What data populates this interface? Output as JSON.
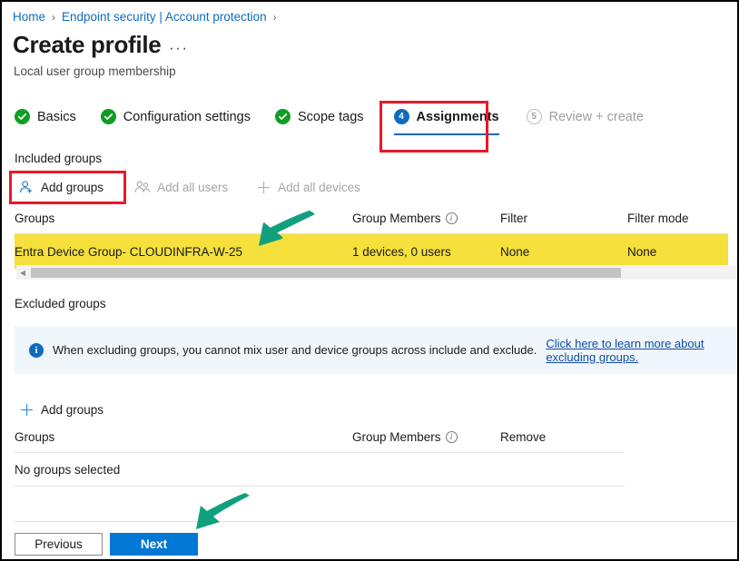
{
  "breadcrumb": {
    "items": [
      {
        "label": "Home",
        "separator": "›"
      },
      {
        "label": "Endpoint security | Account protection",
        "separator": "›"
      }
    ]
  },
  "header": {
    "title": "Create profile",
    "ellipsis": "···",
    "subtitle": "Local user group membership"
  },
  "wizard": {
    "steps": [
      {
        "label": "Basics",
        "state": "complete",
        "marker": "check"
      },
      {
        "label": "Configuration settings",
        "state": "complete",
        "marker": "check"
      },
      {
        "label": "Scope tags",
        "state": "complete",
        "marker": "check"
      },
      {
        "label": "Assignments",
        "state": "active",
        "marker": "4"
      },
      {
        "label": "Review + create",
        "state": "disabled",
        "marker": "5"
      }
    ]
  },
  "included": {
    "section_label": "Included groups",
    "commands": [
      {
        "label": "Add groups",
        "icon": "add-user-icon",
        "enabled": true
      },
      {
        "label": "Add all users",
        "icon": "users-icon",
        "enabled": false
      },
      {
        "label": "Add all devices",
        "icon": "plus-icon",
        "enabled": false
      }
    ],
    "columns": [
      "Groups",
      "Group Members",
      "Filter",
      "Filter mode"
    ],
    "rows": [
      {
        "group": "Entra Device Group- CLOUDINFRA-W-25",
        "members": "1 devices, 0 users",
        "filter": "None",
        "filter_mode": "None",
        "highlighted": true
      }
    ]
  },
  "excluded": {
    "section_label": "Excluded groups",
    "banner": {
      "text": "When excluding groups, you cannot mix user and device groups across include and exclude.",
      "link": "Click here to learn more about excluding groups."
    },
    "command": {
      "label": "Add groups",
      "icon": "plus-icon"
    },
    "columns": [
      "Groups",
      "Group Members",
      "Remove"
    ],
    "empty_text": "No groups selected"
  },
  "footer": {
    "previous_label": "Previous",
    "next_label": "Next"
  },
  "colors": {
    "accent_blue": "#0f6cbd",
    "primary_button": "#0078d4",
    "complete_green": "#0f9d23",
    "highlight_yellow": "#f5e03c",
    "annotation_red": "#e8192c",
    "annotation_teal": "#11a07e",
    "banner_bg": "#eff6fc"
  }
}
